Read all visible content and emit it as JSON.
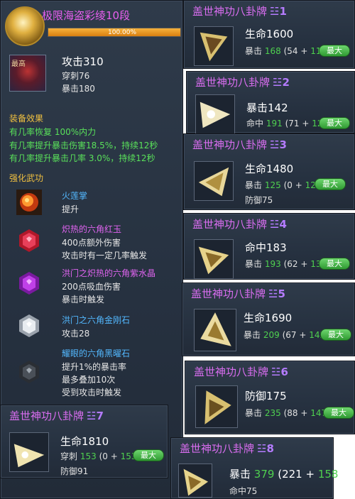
{
  "main": {
    "title": "极限海盗彩绫10段",
    "progress_text": "100.00%",
    "progress_value": 1.0,
    "rarity": "最高",
    "attack": "攻击310",
    "pierce": "穿刺76",
    "crit": "暴击180",
    "effects_header": "装备效果",
    "effects": [
      "有几率恢复 100%内力",
      "有几率提升暴击伤害18.5%，持续12秒",
      "有几率提升暴击几率 3.0%，持续12秒"
    ],
    "skills_header": "强化武功",
    "gems": [
      {
        "name": "火莲掌",
        "name_color": "#53b8ff",
        "lines": [
          "提升"
        ]
      },
      {
        "name": "炽热的六角红玉",
        "name_color": "#e064f0",
        "lines": [
          "400点额外伤害",
          "攻击时有一定几率触发"
        ]
      },
      {
        "name": "洪门之炽热的六角紫水晶",
        "name_color": "#e064f0",
        "lines": [
          "200点吸血伤害",
          "暴击时触发"
        ]
      },
      {
        "name": "洪门之六角金刚石",
        "name_color": "#53b8ff",
        "lines": [
          "攻击28"
        ]
      },
      {
        "name": "耀眼的六角黑曜石",
        "name_color": "#53b8ff",
        "lines": [
          "提升1%的暴击率",
          "最多叠加10次",
          "受到攻击时触发"
        ]
      }
    ]
  },
  "cards": [
    {
      "title": "盖世神功八卦牌",
      "grade": "☳1",
      "main": "生命1600",
      "l1_label": "暴击",
      "l1_total": "168",
      "l1_a": "54",
      "l1_b": "114",
      "extra": "",
      "max": "最大"
    },
    {
      "title": "盖世神功八卦牌",
      "grade": "☳2",
      "main": "暴击142",
      "l1_label": "命中",
      "l1_total": "191",
      "l1_a": "71",
      "l1_b": "120",
      "extra": "",
      "max": "最大"
    },
    {
      "title": "盖世神功八卦牌",
      "grade": "☳3",
      "main": "生命1480",
      "l1_label": "暴击",
      "l1_total": "125",
      "l1_a": "0",
      "l1_b": "125",
      "extra": "防御75",
      "max": "最大"
    },
    {
      "title": "盖世神功八卦牌",
      "grade": "☳4",
      "main": "命中183",
      "l1_label": "暴击",
      "l1_total": "193",
      "l1_a": "62",
      "l1_b": "131",
      "extra": "",
      "max": "最大"
    },
    {
      "title": "盖世神功八卦牌",
      "grade": "☳5",
      "main": "生命1690",
      "l1_label": "暴击",
      "l1_total": "209",
      "l1_a": "67",
      "l1_b": "142",
      "extra": "",
      "max": "最大"
    },
    {
      "title": "盖世神功八卦牌",
      "grade": "☳6",
      "main": "防御175",
      "l1_label": "暴击",
      "l1_total": "235",
      "l1_a": "88",
      "l1_b": "147",
      "extra": "",
      "max": "最大"
    },
    {
      "title": "盖世神功八卦牌",
      "grade": "☳7",
      "main": "生命1810",
      "l1_label": "穿刺",
      "l1_total": "153",
      "l1_a": "0",
      "l1_b": "153",
      "extra": "防御91",
      "max": "最大"
    },
    {
      "title": "盖世神功八卦牌",
      "grade": "☳8",
      "main": "暴击",
      "main_value": "379",
      "l1_label": "",
      "l1_total": "",
      "l1_a": "221",
      "l1_b": "158",
      "extra": "命中75",
      "max": ""
    }
  ]
}
